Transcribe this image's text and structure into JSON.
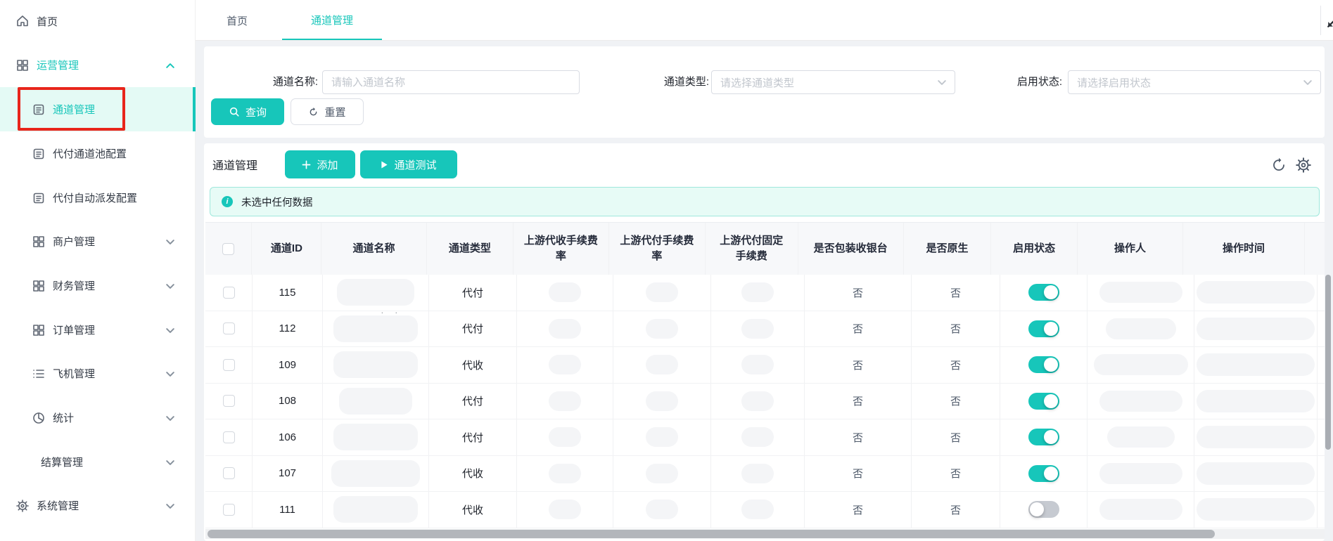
{
  "accent": "#17c6ba",
  "annotation": {
    "red_box_target": "通道管理"
  },
  "sidebar": {
    "items": [
      {
        "label": "首页",
        "icon": "home-icon",
        "level": "top"
      },
      {
        "label": "运营管理",
        "icon": "grid-icon",
        "level": "top",
        "caret": "up",
        "active": true
      },
      {
        "label": "通道管理",
        "icon": "doc-icon",
        "level": "sub",
        "selected": true
      },
      {
        "label": "代付通道池配置",
        "icon": "doc-icon",
        "level": "sub"
      },
      {
        "label": "代付自动派发配置",
        "icon": "doc-icon",
        "level": "sub"
      },
      {
        "label": "商户管理",
        "icon": "grid-icon",
        "level": "sub",
        "caret": "down"
      },
      {
        "label": "财务管理",
        "icon": "grid-icon",
        "level": "sub",
        "caret": "down"
      },
      {
        "label": "订单管理",
        "icon": "grid-icon",
        "level": "sub",
        "caret": "down"
      },
      {
        "label": "飞机管理",
        "icon": "list-icon",
        "level": "sub",
        "caret": "down"
      },
      {
        "label": "统计",
        "icon": "pie-icon",
        "level": "sub",
        "caret": "down"
      },
      {
        "label": "结算管理",
        "icon": null,
        "level": "sub",
        "caret": "down"
      },
      {
        "label": "系统管理",
        "icon": "gear-icon",
        "level": "top",
        "caret": "down"
      }
    ]
  },
  "tabs": [
    {
      "label": "首页",
      "active": false
    },
    {
      "label": "通道管理",
      "active": true
    }
  ],
  "filters": {
    "name": {
      "label": "通道名称:",
      "placeholder": "请输入通道名称"
    },
    "type": {
      "label": "通道类型:",
      "placeholder": "请选择通道类型"
    },
    "status": {
      "label": "启用状态:",
      "placeholder": "请选择启用状态"
    },
    "search_label": "查询",
    "reset_label": "重置"
  },
  "section": {
    "title": "通道管理",
    "add_label": "添加",
    "test_label": "通道测试"
  },
  "alert": {
    "message": "未选中任何数据"
  },
  "table": {
    "columns": [
      "通道ID",
      "通道名称",
      "通道类型",
      "上游代收手续费率",
      "上游代付手续费率",
      "上游代付固定手续费",
      "是否包装收银台",
      "是否原生",
      "启用状态",
      "操作人",
      "操作时间"
    ],
    "rows": [
      {
        "id": "115",
        "type": "代付",
        "cashier": "否",
        "native": "否",
        "enabled": true
      },
      {
        "id": "112",
        "type": "代付",
        "cashier": "否",
        "native": "否",
        "enabled": true
      },
      {
        "id": "109",
        "type": "代收",
        "cashier": "否",
        "native": "否",
        "enabled": true
      },
      {
        "id": "108",
        "type": "代付",
        "cashier": "否",
        "native": "否",
        "enabled": true
      },
      {
        "id": "106",
        "type": "代付",
        "cashier": "否",
        "native": "否",
        "enabled": true
      },
      {
        "id": "107",
        "type": "代收",
        "cashier": "否",
        "native": "否",
        "enabled": true
      },
      {
        "id": "111",
        "type": "代收",
        "cashier": "否",
        "native": "否",
        "enabled": false
      }
    ]
  }
}
